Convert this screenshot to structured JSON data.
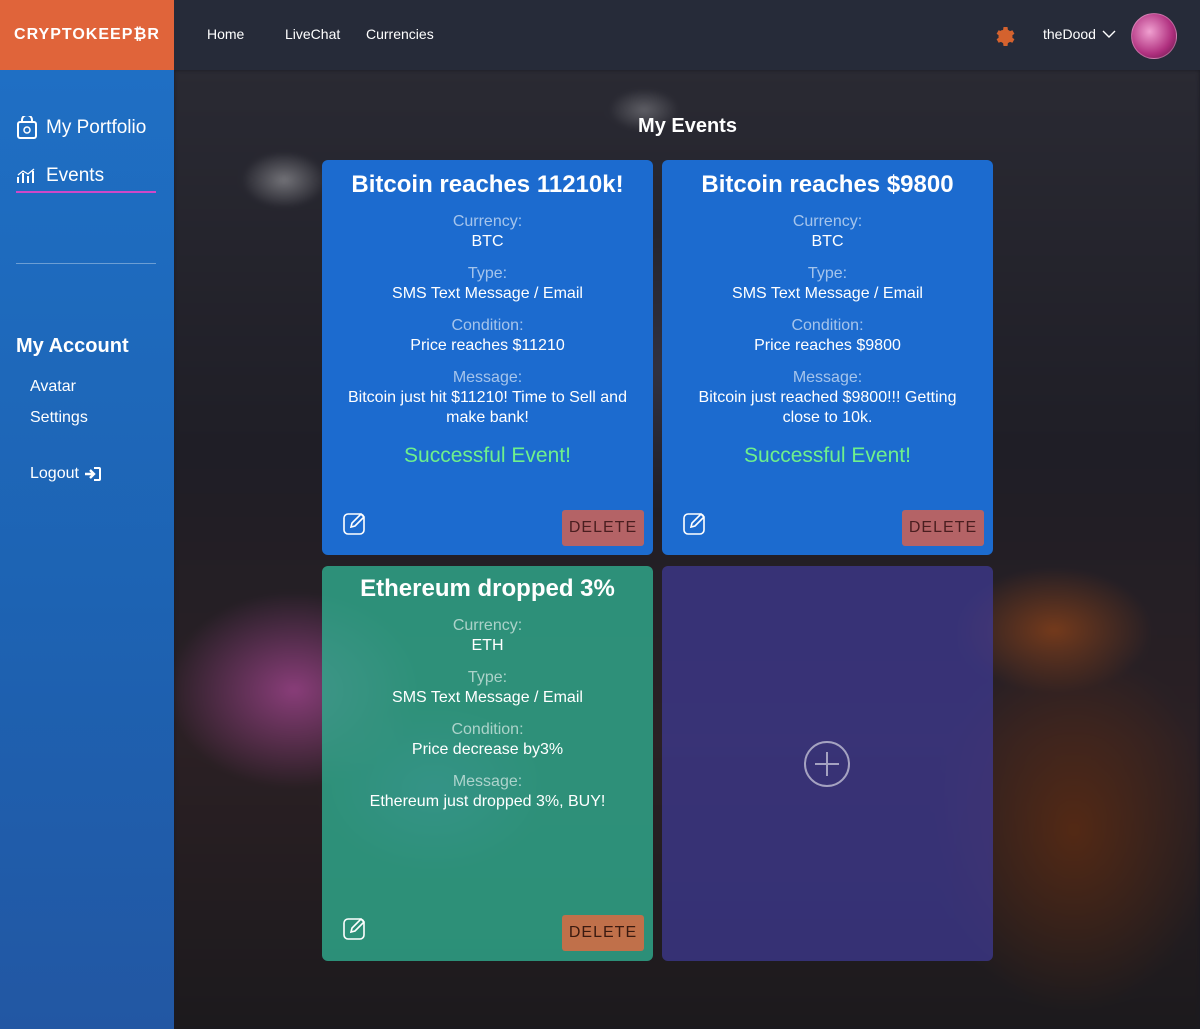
{
  "header": {
    "logo_text": "CRYPTOKEEP₿R",
    "nav": [
      "Home",
      "LiveChat",
      "Currencies"
    ],
    "user_name": "theDood"
  },
  "sidebar": {
    "items": [
      {
        "label": "My Portfolio",
        "icon": "wallet-icon"
      },
      {
        "label": "Events",
        "icon": "chart-icon"
      }
    ],
    "account_heading": "My Account",
    "account_items": [
      "Avatar",
      "Settings"
    ],
    "logout": "Logout"
  },
  "main": {
    "title": "My Events",
    "labels": {
      "currency": "Currency:",
      "type": "Type:",
      "condition": "Condition:",
      "message": "Message:"
    },
    "delete_label": "DELETE",
    "events": [
      {
        "title": "Bitcoin reaches 11210k!",
        "currency": "BTC",
        "type": "SMS Text Message / Email",
        "condition": "Price reaches $11210",
        "message": "Bitcoin just hit $11210! Time to Sell and make bank!",
        "status": "Successful Event!"
      },
      {
        "title": "Bitcoin reaches $9800",
        "currency": "BTC",
        "type": "SMS Text Message / Email",
        "condition": "Price reaches $9800",
        "message": "Bitcoin just reached $9800!!! Getting close to 10k.",
        "status": "Successful Event!"
      },
      {
        "title": "Ethereum dropped 3%",
        "currency": "ETH",
        "type": "SMS Text Message / Email",
        "condition": "Price decrease by3%",
        "message": "Ethereum just dropped 3%, BUY!",
        "status": ""
      }
    ]
  },
  "colors": {
    "logo_bg": "#e0643a",
    "sidebar_bg": "#1f6fc4",
    "card_blue": "#1c6bcf",
    "card_teal": "#30aa8c",
    "card_add": "#3e3a96",
    "success": "#6ef08c",
    "delete_bg": "#b46366"
  }
}
